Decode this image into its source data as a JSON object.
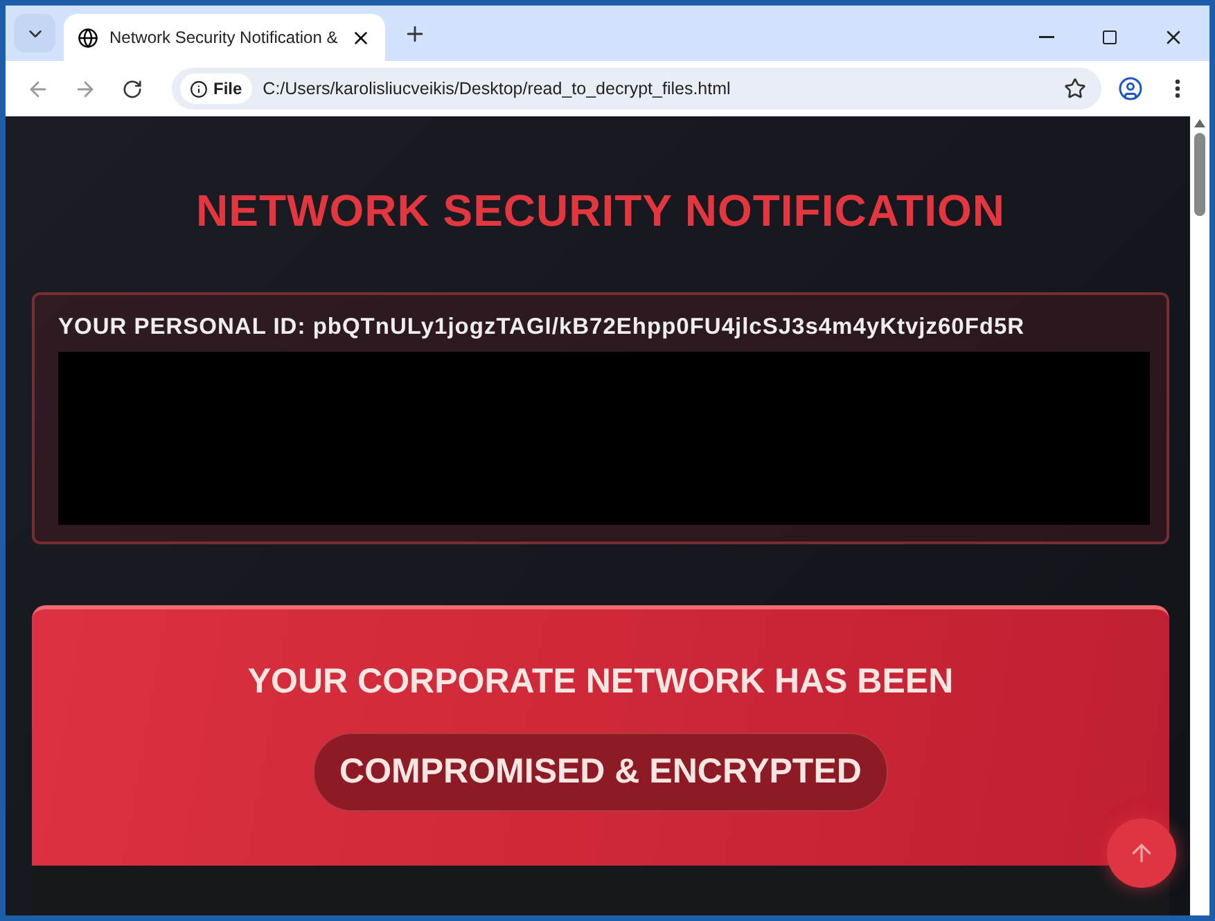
{
  "browser": {
    "tab": {
      "title": "Network Security Notification &",
      "selected": true
    },
    "address": {
      "scheme": "File",
      "url": "C:/Users/karolisliucveikis/Desktop/read_to_decrypt_files.html"
    }
  },
  "page": {
    "heading": "NETWORK SECURITY NOTIFICATION",
    "id_panel": {
      "label": "YOUR PERSONAL ID:",
      "value": "pbQTnULy1jogzTAGl/kB72Ehpp0FU4jlcSJ3s4m4yKtvjz60Fd5R"
    },
    "alert": {
      "line": "YOUR CORPORATE NETWORK HAS BEEN",
      "badge": "COMPROMISED & ENCRYPTED"
    }
  }
}
